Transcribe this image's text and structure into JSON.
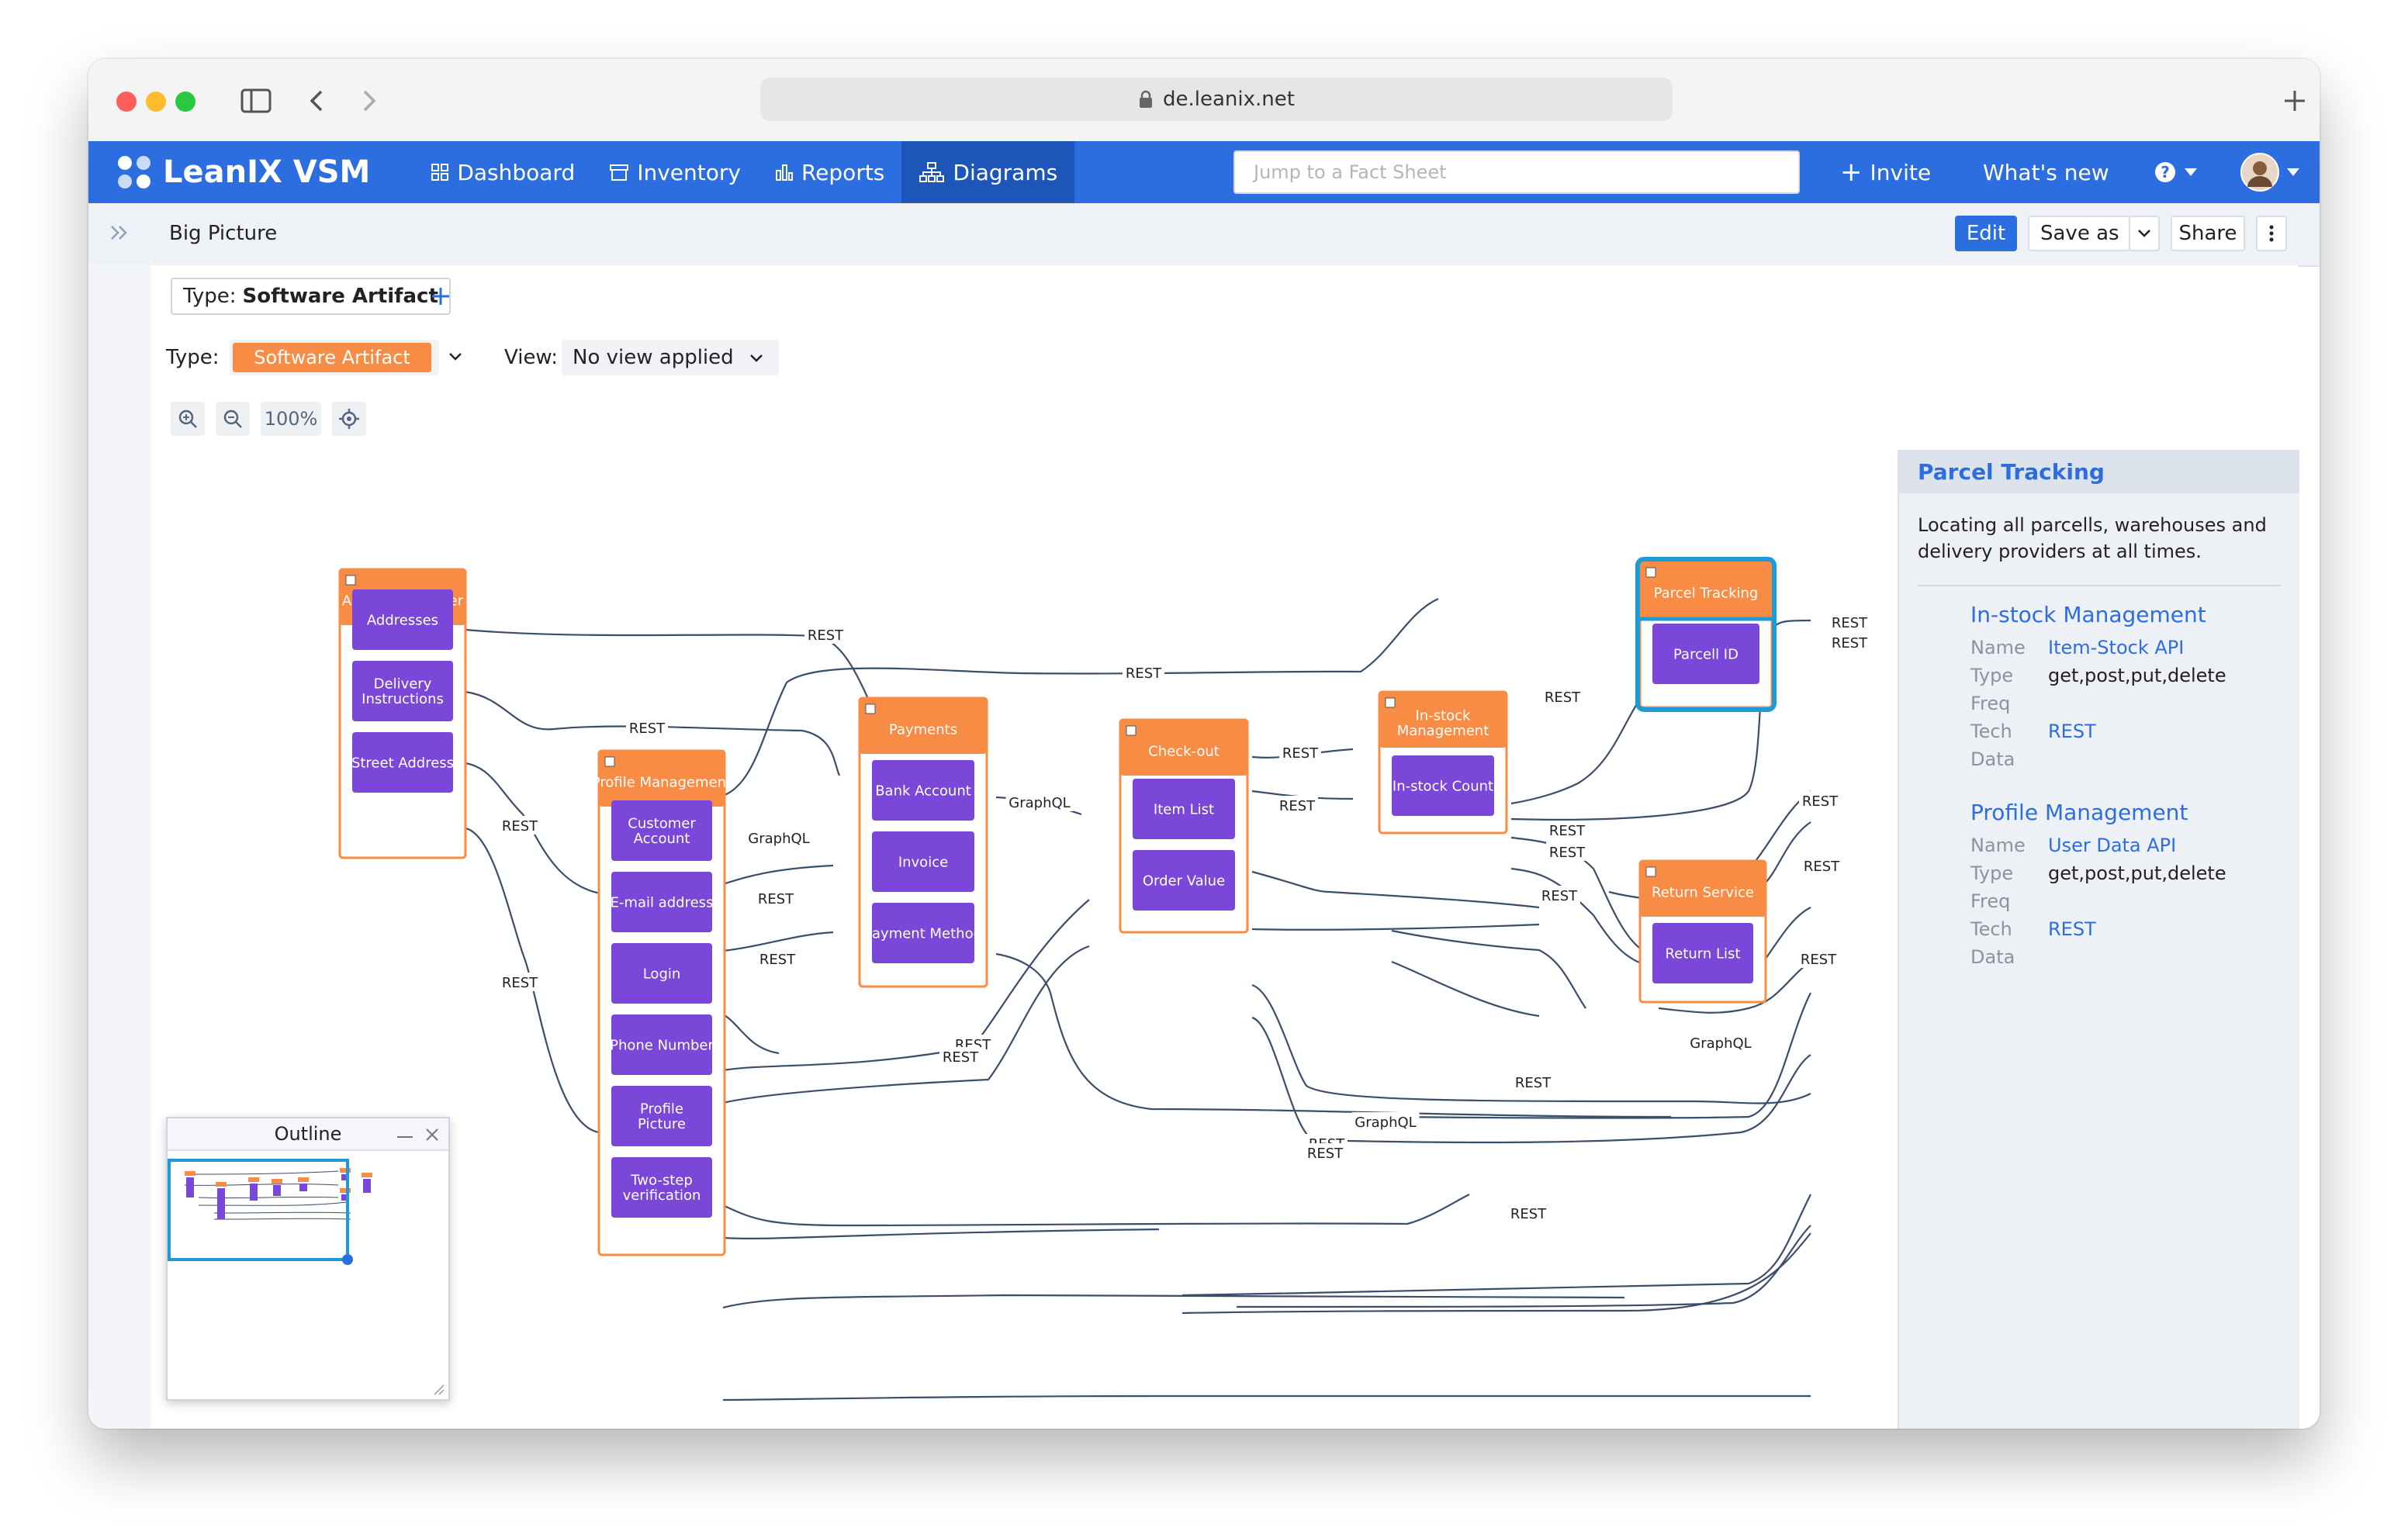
{
  "browser": {
    "url": "de.leanix.net"
  },
  "nav": {
    "brand": "LeanIX VSM",
    "items": [
      {
        "label": "Dashboard",
        "icon": "grid-icon"
      },
      {
        "label": "Inventory",
        "icon": "inventory-icon"
      },
      {
        "label": "Reports",
        "icon": "bar-chart-icon"
      },
      {
        "label": "Diagrams",
        "icon": "hierarchy-icon"
      }
    ],
    "search_placeholder": "Jump to a Fact Sheet",
    "invite": "Invite",
    "whats_new": "What's new"
  },
  "subheader": {
    "page_title": "Big Picture",
    "edit": "Edit",
    "save_as": "Save as",
    "share": "Share"
  },
  "filter": {
    "label": "Type:",
    "value": "Software Artifact"
  },
  "typebar": {
    "type_label": "Type:",
    "type_value": "Software Artifact",
    "view_label": "View:",
    "view_value": "No view applied"
  },
  "zoom": {
    "level": "100%"
  },
  "diagram": {
    "groups": [
      {
        "id": "address",
        "title": "Address Manager",
        "children": [
          "Addresses",
          "Delivery Instructions",
          "Street Address"
        ]
      },
      {
        "id": "profile",
        "title": "Profile Management",
        "children": [
          "Customer Account",
          "E-mail address",
          "Login",
          "Phone Number",
          "Profile Picture",
          "Two-step verification"
        ]
      },
      {
        "id": "payments",
        "title": "Payments",
        "children": [
          "Bank Account",
          "Invoice",
          "Payment Method"
        ]
      },
      {
        "id": "checkout",
        "title": "Check-out",
        "children": [
          "Item List",
          "Order Value"
        ]
      },
      {
        "id": "instock",
        "title": "In-stock Management",
        "children": [
          "In-stock Count"
        ]
      },
      {
        "id": "parcel",
        "title": "Parcel Tracking",
        "children": [
          "Parcell ID"
        ]
      },
      {
        "id": "return",
        "title": "Return Service",
        "children": [
          "Return List"
        ]
      }
    ],
    "edge_labels": [
      "REST",
      "REST",
      "REST",
      "REST",
      "REST",
      "GraphQL",
      "GraphQL",
      "REST",
      "REST",
      "REST",
      "REST",
      "REST",
      "REST",
      "REST",
      "REST",
      "REST",
      "REST",
      "REST",
      "REST",
      "REST",
      "REST",
      "GraphQL",
      "REST",
      "GraphQL",
      "REST",
      "REST",
      "REST",
      "REST"
    ],
    "colors": {
      "group": "#f98c45",
      "child": "#7b47d8",
      "line": "#3a4d6b",
      "selected": "#1d9bd8"
    }
  },
  "outline": {
    "title": "Outline"
  },
  "panel": {
    "title": "Parcel Tracking",
    "description": "Locating all parcells, warehouses and delivery providers at all times.",
    "sections": [
      {
        "heading": "In-stock Management",
        "name": "Item-Stock API",
        "type": "get,post,put,delete",
        "freq": "",
        "tech": "REST",
        "data": ""
      },
      {
        "heading": "Profile Management",
        "name": "User Data API",
        "type": "get,post,put,delete",
        "freq": "",
        "tech": "REST",
        "data": ""
      }
    ],
    "labels": {
      "name": "Name",
      "type": "Type",
      "freq": "Freq",
      "tech": "Tech",
      "data": "Data"
    }
  }
}
